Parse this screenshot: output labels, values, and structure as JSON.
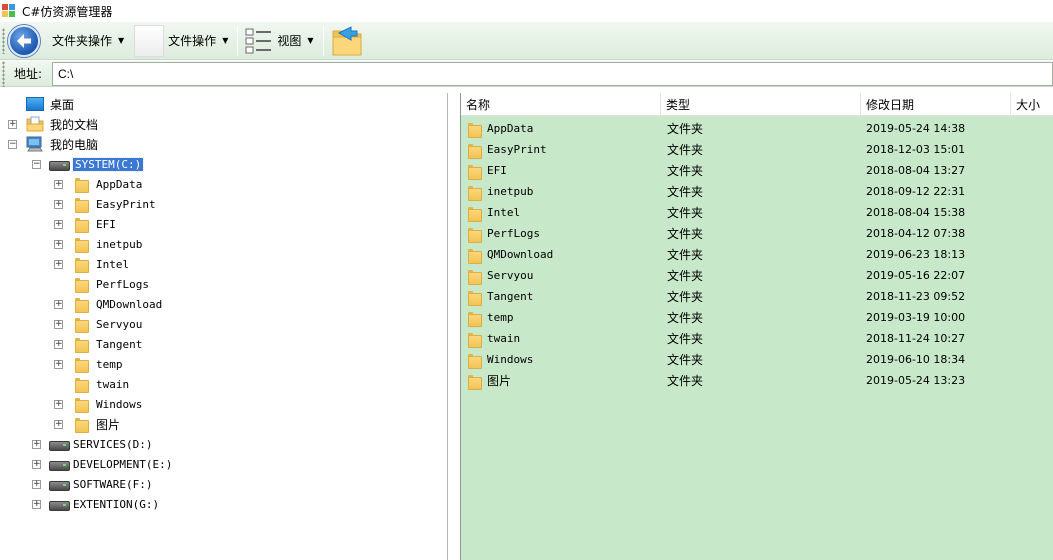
{
  "window": {
    "title": "C#仿资源管理器"
  },
  "toolbar": {
    "folder_ops_label": "文件夹操作",
    "file_ops_label": "文件操作",
    "view_label": "视图",
    "dropdown_arrow": "▼"
  },
  "address": {
    "label": "地址:",
    "value": "C:\\"
  },
  "tree": {
    "desktop": "桌面",
    "my_documents": "我的文档",
    "my_computer": "我的电脑",
    "drive_c": "SYSTEM(C:)",
    "c_children": [
      {
        "label": "AppData",
        "expandable": true
      },
      {
        "label": "EasyPrint",
        "expandable": true
      },
      {
        "label": "EFI",
        "expandable": true
      },
      {
        "label": "inetpub",
        "expandable": true
      },
      {
        "label": "Intel",
        "expandable": true
      },
      {
        "label": "PerfLogs",
        "expandable": false
      },
      {
        "label": "QMDownload",
        "expandable": true
      },
      {
        "label": "Servyou",
        "expandable": true
      },
      {
        "label": "Tangent",
        "expandable": true
      },
      {
        "label": "temp",
        "expandable": true
      },
      {
        "label": "twain",
        "expandable": false
      },
      {
        "label": "Windows",
        "expandable": true
      },
      {
        "label": "图片",
        "expandable": true
      }
    ],
    "other_drives": [
      "SERVICES(D:)",
      "DEVELOPMENT(E:)",
      "SOFTWARE(F:)",
      "EXTENTION(G:)"
    ],
    "expand_symbol": "+",
    "collapse_symbol": "−"
  },
  "list": {
    "columns": [
      "名称",
      "类型",
      "修改日期",
      "大小"
    ],
    "rows": [
      {
        "name": "AppData",
        "type": "文件夹",
        "modified": "2019-05-24 14:38"
      },
      {
        "name": "EasyPrint",
        "type": "文件夹",
        "modified": "2018-12-03 15:01"
      },
      {
        "name": "EFI",
        "type": "文件夹",
        "modified": "2018-08-04 13:27"
      },
      {
        "name": "inetpub",
        "type": "文件夹",
        "modified": "2018-09-12 22:31"
      },
      {
        "name": "Intel",
        "type": "文件夹",
        "modified": "2018-08-04 15:38"
      },
      {
        "name": "PerfLogs",
        "type": "文件夹",
        "modified": "2018-04-12 07:38"
      },
      {
        "name": "QMDownload",
        "type": "文件夹",
        "modified": "2019-06-23 18:13"
      },
      {
        "name": "Servyou",
        "type": "文件夹",
        "modified": "2019-05-16 22:07"
      },
      {
        "name": "Tangent",
        "type": "文件夹",
        "modified": "2018-11-23 09:52"
      },
      {
        "name": "temp",
        "type": "文件夹",
        "modified": "2019-03-19 10:00"
      },
      {
        "name": "twain",
        "type": "文件夹",
        "modified": "2018-11-24 10:27"
      },
      {
        "name": "Windows",
        "type": "文件夹",
        "modified": "2019-06-10 18:34"
      },
      {
        "name": "图片",
        "type": "文件夹",
        "modified": "2019-05-24 13:23"
      }
    ]
  },
  "colors": {
    "list_background": "#c8e8ca",
    "toolbar_background": "#dcecdc",
    "selection": "#3b78d4",
    "folder": "#f2c455"
  }
}
